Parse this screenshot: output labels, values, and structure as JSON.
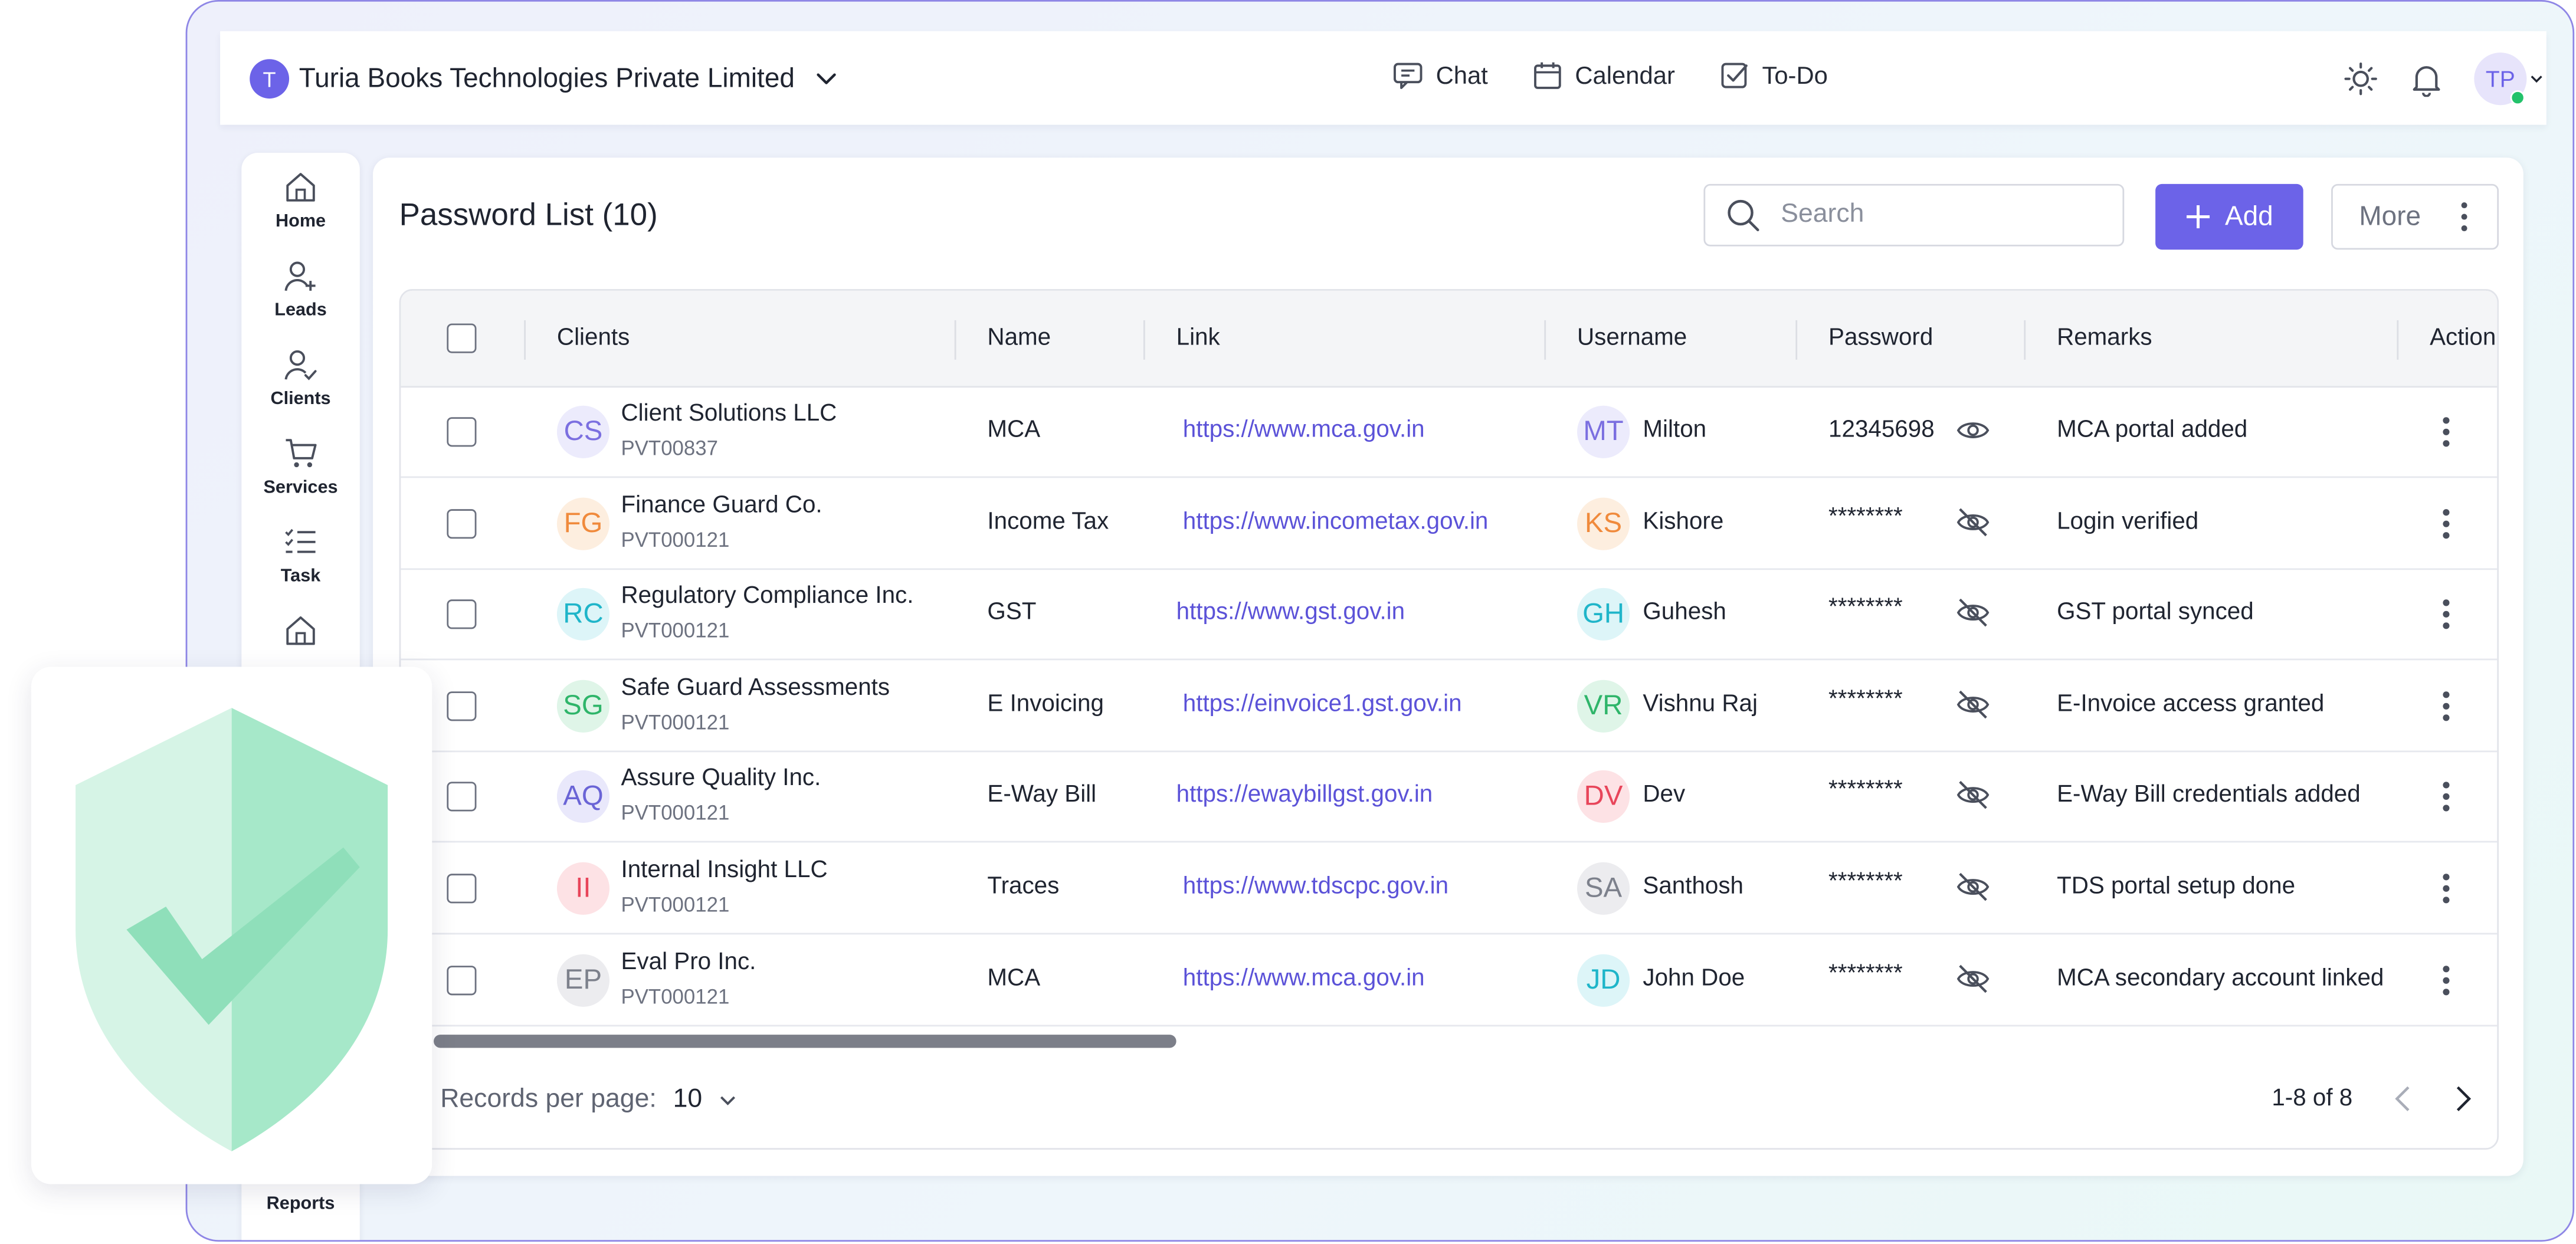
{
  "topbar": {
    "org_initial": "T",
    "org_name": "Turia Books Technologies Private Limited",
    "nav": [
      {
        "label": "Chat",
        "icon": "chat-icon"
      },
      {
        "label": "Calendar",
        "icon": "calendar-icon"
      },
      {
        "label": "To-Do",
        "icon": "todo-icon"
      }
    ],
    "user_initials": "TP"
  },
  "sidebar": {
    "items": [
      {
        "label": "Home",
        "icon": "home-icon"
      },
      {
        "label": "Leads",
        "icon": "add-user-icon"
      },
      {
        "label": "Clients",
        "icon": "user-check-icon"
      },
      {
        "label": "Services",
        "icon": "cart-icon"
      },
      {
        "label": "Task",
        "icon": "task-list-icon"
      },
      {
        "label": "",
        "icon": "home-icon"
      }
    ],
    "bottom_label": "Reports"
  },
  "main": {
    "title": "Password List (10)",
    "search_placeholder": "Search",
    "add_label": "Add",
    "more_label": "More",
    "columns": [
      "Clients",
      "Name",
      "Link",
      "Username",
      "Password",
      "Remarks",
      "Action"
    ],
    "rows": [
      {
        "initials": "CS",
        "client": "Client Solutions LLC",
        "client_id": "PVT00837",
        "name": "MCA",
        "link": "https://www.mca.gov.in",
        "user_initials": "MT",
        "username": "Milton",
        "password": "12345698",
        "visible": true,
        "remarks": "MCA portal added",
        "color": "#7b6fe0",
        "bg": "#ecebfc"
      },
      {
        "initials": "FG",
        "client": "Finance Guard Co.",
        "client_id": "PVT000121",
        "name": "Income Tax",
        "link": "https://www.incometax.gov.in",
        "user_initials": "KS",
        "username": "Kishore",
        "password": "********",
        "visible": false,
        "remarks": " Login verified",
        "color": "#f08a3c",
        "bg": "#fdeedf"
      },
      {
        "initials": "RC",
        "client": "Regulatory Compliance Inc.",
        "client_id": "PVT000121",
        "name": "GST",
        "link": "https://www.gst.gov.in",
        "user_initials": "GH",
        "username": "Guhesh",
        "password": "********",
        "visible": false,
        "remarks": "GST portal synced",
        "color": "#1fb5c9",
        "bg": "#ddf5f8"
      },
      {
        "initials": "SG",
        "client": "Safe Guard Assessments",
        "client_id": "PVT000121",
        "name": "E Invoicing",
        "link": "https://einvoice1.gst.gov.in",
        "user_initials": "VR",
        "username": "Vishnu Raj",
        "password": "********",
        "visible": false,
        "remarks": "E-Invoice access granted",
        "color": "#2fb56a",
        "bg": "#dff5e8"
      },
      {
        "initials": "AQ",
        "client": "Assure Quality Inc.",
        "client_id": "PVT000121",
        "name": "E-Way Bill",
        "link": "https://ewaybillgst.gov.in",
        "user_initials": "DV",
        "username": "Dev",
        "password": "********",
        "visible": false,
        "remarks": "E-Way Bill credentials added",
        "color": "#6a64d6",
        "bg": "#e9e8fb"
      },
      {
        "initials": "II",
        "client": "Internal Insight LLC",
        "client_id": "PVT000121",
        "name": "Traces",
        "link": "https://www.tdscpc.gov.in",
        "user_initials": "SA",
        "username": "Santhosh",
        "password": "********",
        "visible": false,
        "remarks": "TDS portal setup done",
        "color": "#e8455a",
        "bg": "#fde2e5"
      },
      {
        "initials": "EP",
        "client": "Eval Pro Inc.",
        "client_id": "PVT000121",
        "name": "MCA",
        "link": "https://www.mca.gov.in",
        "user_initials": "JD",
        "username": "John Doe",
        "password": "********",
        "visible": false,
        "remarks": "MCA secondary account linked",
        "color": "#7d818c",
        "bg": "#ececef"
      }
    ],
    "row_user_colors": [
      {
        "color": "#7b6fe0",
        "bg": "#ecebfc"
      },
      {
        "color": "#f08a3c",
        "bg": "#fdeedf"
      },
      {
        "color": "#1fb5c9",
        "bg": "#ddf5f8"
      },
      {
        "color": "#2fb56a",
        "bg": "#dff5e8"
      },
      {
        "color": "#e8455a",
        "bg": "#fde2e5"
      },
      {
        "color": "#7d818c",
        "bg": "#ececef"
      },
      {
        "color": "#1fb5c9",
        "bg": "#ddf5f8"
      }
    ],
    "records_per_page_label": "Records per page:",
    "records_per_page": "10",
    "pagination": "1-8 of 8"
  },
  "colors": {
    "accent": "#6c63e8",
    "link": "#5b52d8",
    "shield_light": "#d6f4e6",
    "shield_dark": "#a6e8c9"
  }
}
